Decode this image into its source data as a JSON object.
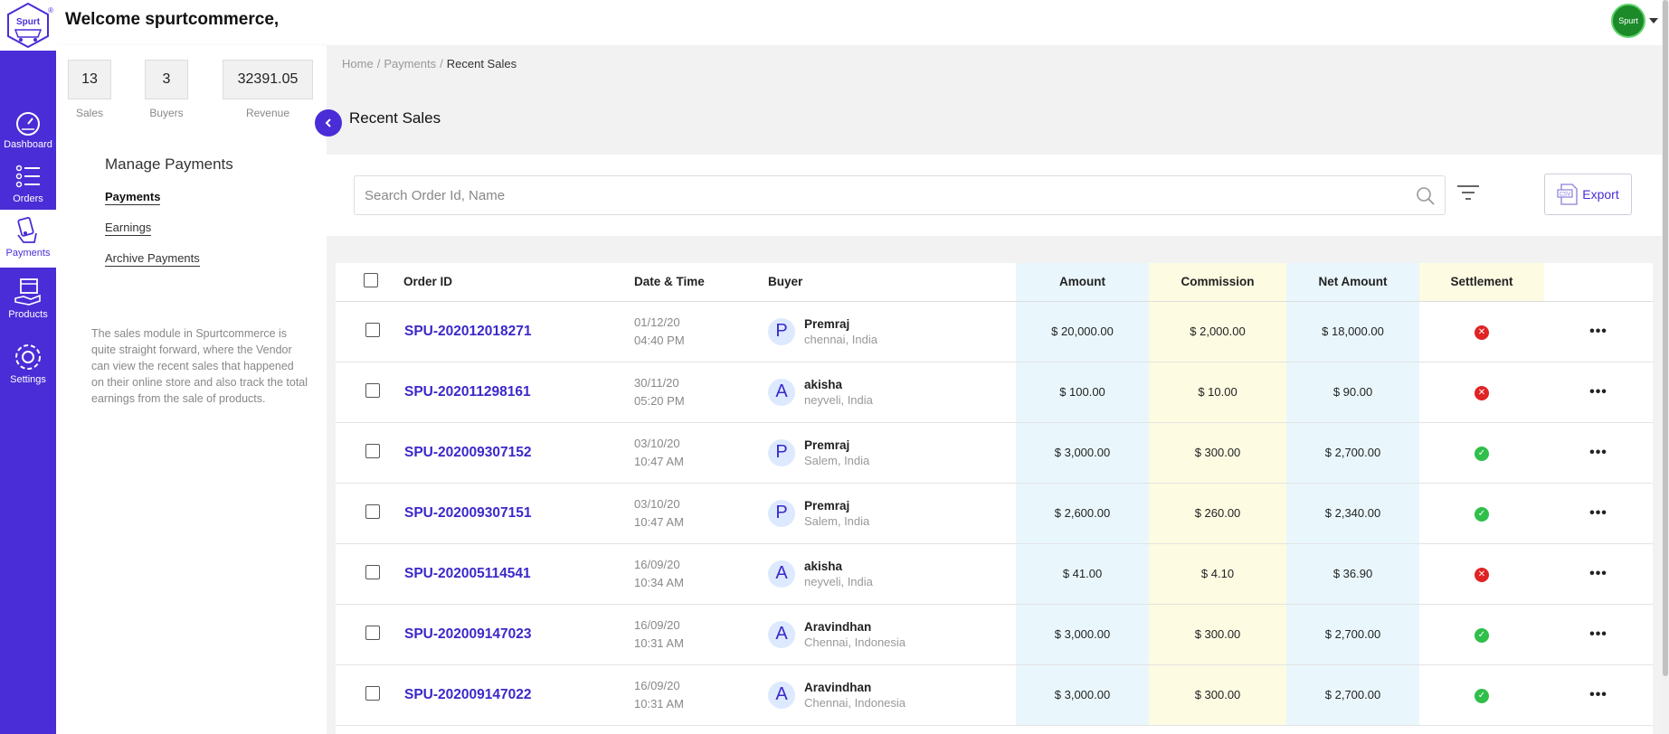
{
  "header": {
    "welcome": "Welcome spurtcommerce,",
    "logo_text": "Spurt",
    "avatar_text": "Spurt"
  },
  "rail": {
    "items": [
      {
        "label": "Dashboard",
        "icon": "speedometer-icon"
      },
      {
        "label": "Orders",
        "icon": "list-icon"
      },
      {
        "label": "Payments",
        "icon": "card-hand-icon"
      },
      {
        "label": "Products",
        "icon": "box-hand-icon"
      },
      {
        "label": "Settings",
        "icon": "gear-icon"
      }
    ]
  },
  "stats": [
    {
      "value": "13",
      "label": "Sales"
    },
    {
      "value": "3",
      "label": "Buyers"
    },
    {
      "value": "32391.05",
      "label": "Revenue"
    }
  ],
  "panel": {
    "title": "Manage Payments",
    "links": [
      "Payments",
      "Earnings",
      "Archive Payments"
    ],
    "description": "The sales module in Spurtcommerce is quite straight forward, where the Vendor can view the recent sales that happened on their online store and also track the total earnings from the sale of products."
  },
  "breadcrumb": [
    "Home",
    "Payments",
    "Recent Sales"
  ],
  "page_title": "Recent Sales",
  "search": {
    "placeholder": "Search Order Id, Name",
    "value": ""
  },
  "export_label": "Export",
  "table": {
    "columns": [
      "Order ID",
      "Date & Time",
      "Buyer",
      "Amount",
      "Commission",
      "Net Amount",
      "Settlement"
    ],
    "rows": [
      {
        "order_id": "SPU-202012018271",
        "date": "01/12/20",
        "time": "04:40 PM",
        "initial": "P",
        "buyer": "Premraj",
        "location": "chennai, India",
        "amount": "$ 20,000.00",
        "commission": "$ 2,000.00",
        "net": "$ 18,000.00",
        "settled": false
      },
      {
        "order_id": "SPU-202011298161",
        "date": "30/11/20",
        "time": "05:20 PM",
        "initial": "A",
        "buyer": "akisha",
        "location": "neyveli, India",
        "amount": "$ 100.00",
        "commission": "$ 10.00",
        "net": "$ 90.00",
        "settled": false
      },
      {
        "order_id": "SPU-202009307152",
        "date": "03/10/20",
        "time": "10:47 AM",
        "initial": "P",
        "buyer": "Premraj",
        "location": "Salem, India",
        "amount": "$ 3,000.00",
        "commission": "$ 300.00",
        "net": "$ 2,700.00",
        "settled": true
      },
      {
        "order_id": "SPU-202009307151",
        "date": "03/10/20",
        "time": "10:47 AM",
        "initial": "P",
        "buyer": "Premraj",
        "location": "Salem, India",
        "amount": "$ 2,600.00",
        "commission": "$ 260.00",
        "net": "$ 2,340.00",
        "settled": true
      },
      {
        "order_id": "SPU-202005114541",
        "date": "16/09/20",
        "time": "10:34 AM",
        "initial": "A",
        "buyer": "akisha",
        "location": "neyveli, India",
        "amount": "$ 41.00",
        "commission": "$ 4.10",
        "net": "$ 36.90",
        "settled": false
      },
      {
        "order_id": "SPU-202009147023",
        "date": "16/09/20",
        "time": "10:31 AM",
        "initial": "A",
        "buyer": "Aravindhan",
        "location": "Chennai, Indonesia",
        "amount": "$ 3,000.00",
        "commission": "$ 300.00",
        "net": "$ 2,700.00",
        "settled": true
      },
      {
        "order_id": "SPU-202009147022",
        "date": "16/09/20",
        "time": "10:31 AM",
        "initial": "A",
        "buyer": "Aravindhan",
        "location": "Chennai, Indonesia",
        "amount": "$ 3,000.00",
        "commission": "$ 300.00",
        "net": "$ 2,700.00",
        "settled": true
      }
    ]
  },
  "colors": {
    "accent": "#4a2dd6",
    "settled": "#2fbf4a",
    "unsettled": "#e02323"
  }
}
